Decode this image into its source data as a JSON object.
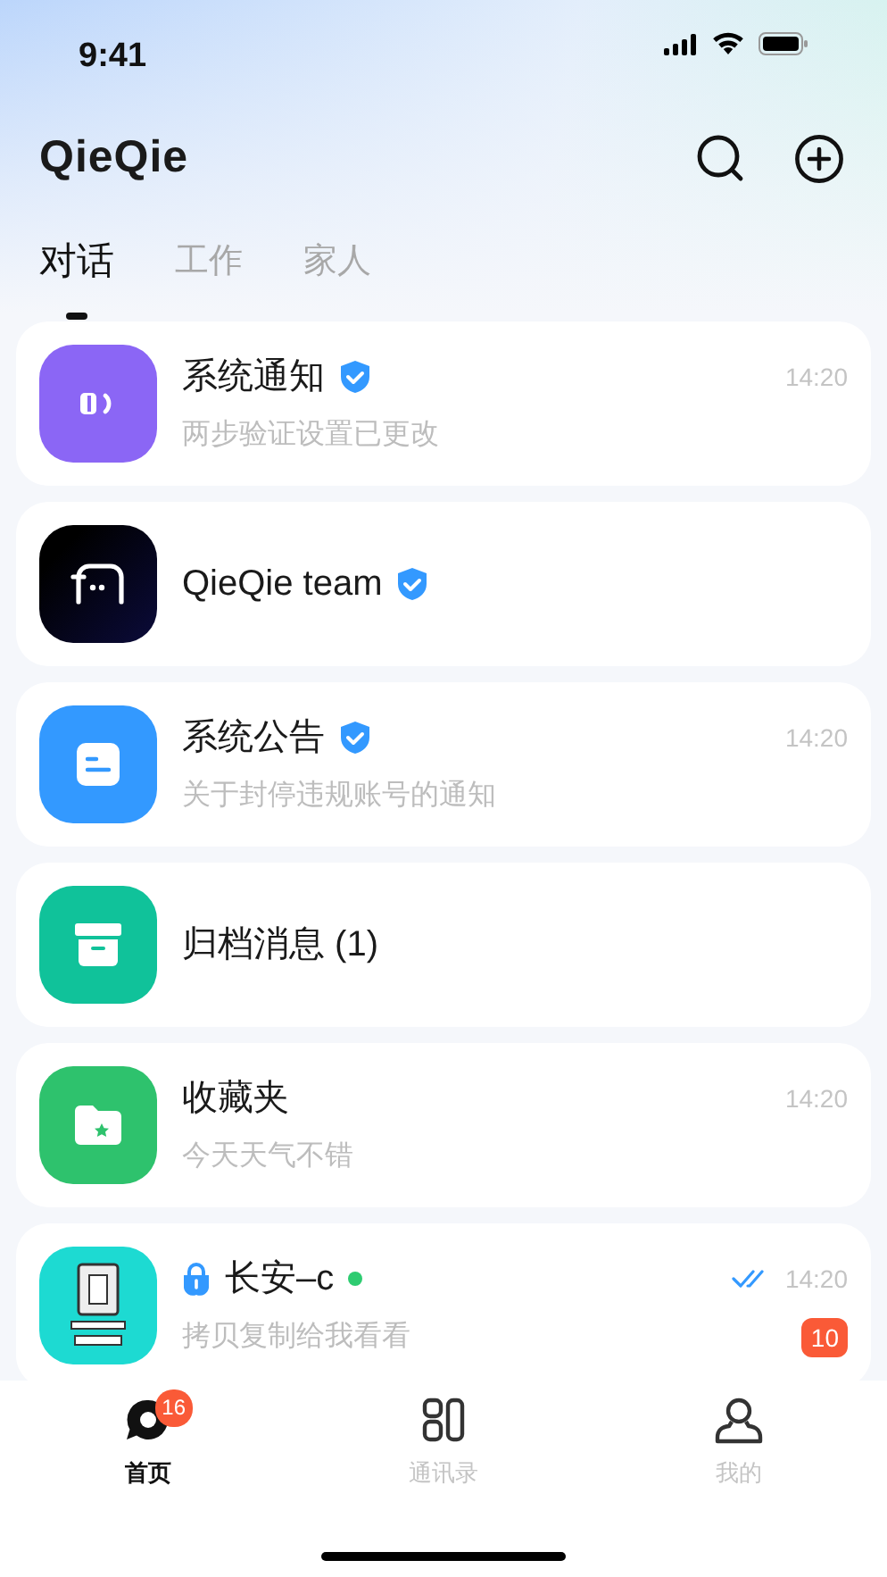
{
  "status_bar": {
    "time": "9:41"
  },
  "app_title": "QieQie",
  "tabs": [
    {
      "label": "对话",
      "selected": true
    },
    {
      "label": "工作",
      "selected": false
    },
    {
      "label": "家人",
      "selected": false
    }
  ],
  "conversations": [
    {
      "kind": "speaker",
      "color": "#8b66f5",
      "title": "系统通知",
      "verified": true,
      "locked": false,
      "online": false,
      "read": false,
      "time": "14:20",
      "preview": "两步验证设置已更改"
    },
    {
      "kind": "team",
      "color": "#0b0b3a",
      "title": "QieQie team",
      "verified": true,
      "locked": false,
      "online": false,
      "read": false
    },
    {
      "kind": "notice",
      "color": "#3399ff",
      "title": "系统公告",
      "verified": true,
      "locked": false,
      "online": false,
      "read": false,
      "time": "14:20",
      "preview": "关于封停违规账号的通知"
    },
    {
      "kind": "archive",
      "color": "#10c29a",
      "title": "归档消息 (1)",
      "verified": false,
      "locked": false,
      "online": false,
      "read": false
    },
    {
      "kind": "folder",
      "color": "#2ec26d",
      "title": "收藏夹",
      "verified": false,
      "locked": false,
      "online": false,
      "read": false,
      "time": "14:20",
      "preview": "今天天气不错"
    },
    {
      "kind": "picture",
      "color": "#1ddad2",
      "title": "长安–c",
      "verified": false,
      "locked": true,
      "online": true,
      "read": true,
      "time": "14:20",
      "preview": "拷贝复制给我看看",
      "unread": "10"
    }
  ],
  "bottom_nav": [
    {
      "kind": "chat",
      "label": "首页",
      "selected": true,
      "badge": "16"
    },
    {
      "kind": "contacts",
      "label": "通讯录",
      "selected": false
    },
    {
      "kind": "person",
      "label": "我的",
      "selected": false
    }
  ]
}
